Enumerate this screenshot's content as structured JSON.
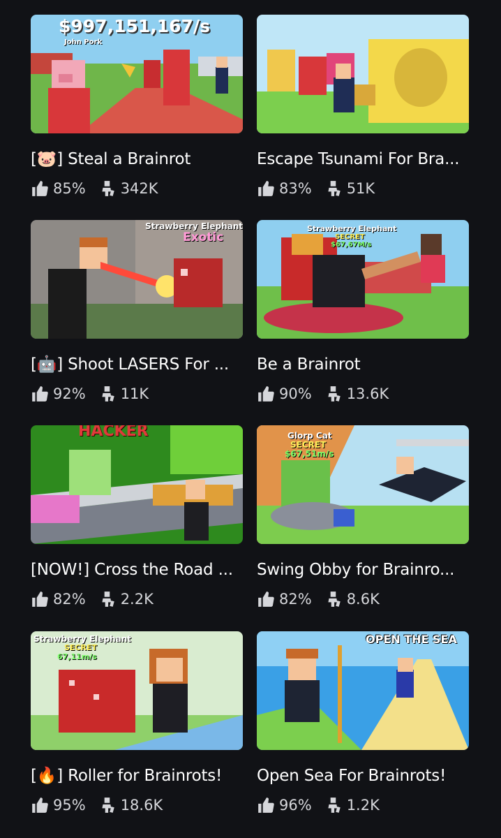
{
  "games": [
    {
      "title": "[🐷] Steal a Brainrot",
      "rating": "85%",
      "players": "342K",
      "thumb_text": [
        "$997,151,167/s",
        "John Pork"
      ]
    },
    {
      "title": "Escape Tsunami For Bra...",
      "rating": "83%",
      "players": "51K",
      "thumb_text": []
    },
    {
      "title": "[🤖] Shoot LASERS For ...",
      "rating": "92%",
      "players": "11K",
      "thumb_text": [
        "Strawberry Elephant",
        "Exotic"
      ]
    },
    {
      "title": "Be a Brainrot",
      "rating": "90%",
      "players": "13.6K",
      "thumb_text": [
        "Strawberry Elephant",
        "SECRET",
        "$67,67M/s"
      ]
    },
    {
      "title": "[NOW!] Cross the Road ...",
      "rating": "82%",
      "players": "2.2K",
      "thumb_text": [
        "HACKER"
      ]
    },
    {
      "title": "Swing Obby for Brainro...",
      "rating": "82%",
      "players": "8.6K",
      "thumb_text": [
        "Glorp Cat",
        "SECRET",
        "$67,51m/s"
      ]
    },
    {
      "title": "[🔥] Roller for Brainrots!",
      "rating": "95%",
      "players": "18.6K",
      "thumb_text": [
        "Strawberry Elephant",
        "SECRET",
        "67,11m/s"
      ]
    },
    {
      "title": "Open Sea For Brainrots!",
      "rating": "96%",
      "players": "1.2K",
      "thumb_text": [
        "OPEN THE SEA"
      ]
    }
  ],
  "icons": {
    "rating": "thumbs-up-icon",
    "players": "players-icon"
  },
  "colors": {
    "background": "#111216",
    "text": "#ffffff",
    "stat_text": "#d6d7db"
  }
}
